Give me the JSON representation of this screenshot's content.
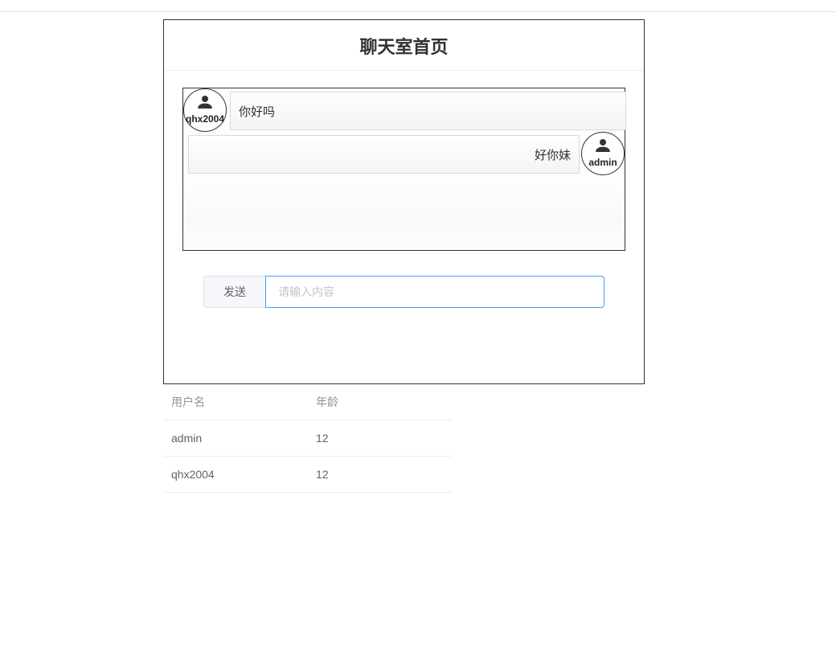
{
  "header": {
    "title": "聊天室首页"
  },
  "chat": {
    "messages": [
      {
        "user": "qhx2004",
        "text": "你好吗",
        "side": "left"
      },
      {
        "user": "admin",
        "text": "好你妹",
        "side": "right"
      }
    ]
  },
  "composer": {
    "send_label": "发送",
    "placeholder": "请输入内容",
    "value": ""
  },
  "user_table": {
    "columns": [
      "用户名",
      "年龄"
    ],
    "rows": [
      {
        "username": "admin",
        "age": "12"
      },
      {
        "username": "qhx2004",
        "age": "12"
      }
    ]
  }
}
